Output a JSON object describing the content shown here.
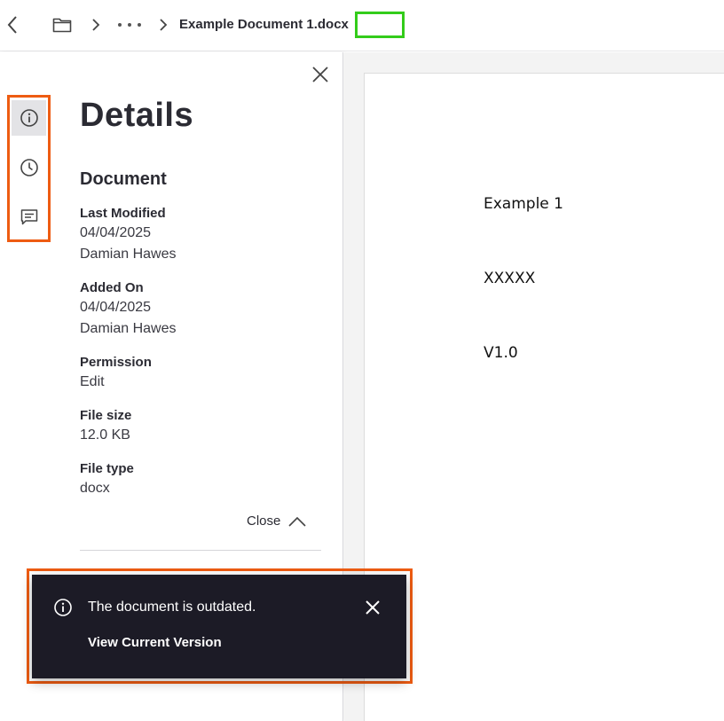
{
  "breadcrumb": {
    "current": "Example Document 1.docx"
  },
  "details": {
    "title": "Details",
    "section": "Document",
    "fields": [
      {
        "label": "Last Modified",
        "values": [
          "04/04/2025",
          "Damian Hawes"
        ]
      },
      {
        "label": "Added On",
        "values": [
          "04/04/2025",
          "Damian Hawes"
        ]
      },
      {
        "label": "Permission",
        "values": [
          "Edit"
        ]
      },
      {
        "label": "File size",
        "values": [
          "12.0 KB"
        ]
      },
      {
        "label": "File type",
        "values": [
          "docx"
        ]
      }
    ],
    "close_label": "Close"
  },
  "document": {
    "lines": [
      "Example 1",
      "XXXXX",
      "V1.0"
    ]
  },
  "toast": {
    "message": "The document is outdated.",
    "link": "View Current Version"
  },
  "icons": {
    "back": "chevron-left-icon",
    "folder": "folder-icon",
    "more": "more-horizontal-icon",
    "rail": [
      "info-icon",
      "clock-icon",
      "comment-icon"
    ]
  },
  "colors": {
    "highlight_orange": "#ee5c12",
    "highlight_green": "#33cc1a",
    "toast_bg": "#1c1b26",
    "rail_active_bg": "#e3e3e6"
  }
}
